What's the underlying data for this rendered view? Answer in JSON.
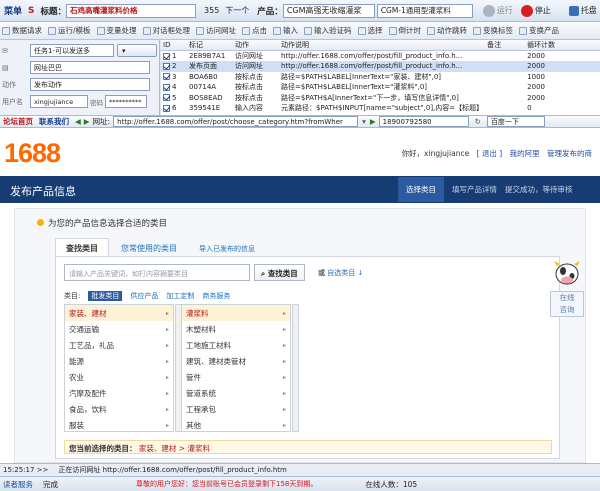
{
  "toolbar": {
    "menu": "菜单",
    "title_label": "标题：",
    "title_value": "石鸡高嘴灌浆料价格",
    "count": "355",
    "next": "下一个",
    "product_label": "产品：",
    "product_value": "CGM高强无收缩灌浆",
    "product_sub": "CGM-1通用型灌浆料",
    "run": "运行",
    "stop": "停止",
    "host": "托盘"
  },
  "actions": [
    "数据请求",
    "运行/模板",
    "变量处理",
    "对话框处理",
    "访问网址",
    "点击",
    "输入",
    "输入验证码",
    "选择",
    "倒计时",
    "动作跳转",
    "变换标签",
    "变换产品"
  ],
  "left_panel": {
    "select1": "任务1-可以发送多",
    "field1": "网址巴巴",
    "action_label": "动作",
    "action_value": "发布动作",
    "user_label": "用户名",
    "user_value": "xingjujiance",
    "pwd_label": "密码",
    "pwd_value": "**********"
  },
  "grid": {
    "headers": [
      "ID",
      "标记",
      "动作",
      "动作说明",
      "备注",
      "循环计数"
    ],
    "rows": [
      {
        "id": "1",
        "mark": "2E89B7A1",
        "action": "访问网址",
        "desc": "http://offer.1688.com/offer/post/fill_product_info.h...",
        "note": "",
        "count": "2000",
        "checked": true,
        "selected": false
      },
      {
        "id": "2",
        "mark": "发布页面",
        "action": "访问网址",
        "desc": "http://offer.1688.com/offer/post/fill_product_info.h...",
        "note": "",
        "count": "2000",
        "checked": true,
        "selected": true
      },
      {
        "id": "3",
        "mark": "BOA6B0",
        "action": "按标点击",
        "desc": "路径=$PATH$LABEL[InnerText=\"家装、建材\",0]",
        "note": "",
        "count": "1000",
        "checked": true,
        "selected": false
      },
      {
        "id": "4",
        "mark": "00714A",
        "action": "按标点击",
        "desc": "路径=$PATH$LABEL[InnerText=\"灌浆料\",0]",
        "note": "",
        "count": "2000",
        "checked": true,
        "selected": false
      },
      {
        "id": "5",
        "mark": "BOS8EAD",
        "action": "按标点击",
        "desc": "路径=$PATH$A[InnerText=\"下一步，填写信息详情\",0]",
        "note": "",
        "count": "2000",
        "checked": true,
        "selected": false
      },
      {
        "id": "6",
        "mark": "359541E",
        "action": "输入内容",
        "desc": "元素路径：$PATH$INPUT[name=\"subject\",0],内容=【标题】",
        "note": "",
        "count": "0",
        "checked": true,
        "selected": false
      },
      {
        "id": "7",
        "mark": "12E7C6",
        "action": "输入内容",
        "desc": "路径=$PATH$INPUT[className=\"sample\",0]",
        "note": "",
        "count": "500",
        "checked": true,
        "selected": false
      }
    ]
  },
  "browser_bar": {
    "link1": "论坛首页",
    "link2": "联系我们",
    "url_label": "网址:",
    "url": "http://offer.1688.com/offer/post/choose_category.htm?fromWher",
    "phone": "18900792580",
    "search": "百度一下"
  },
  "site": {
    "logo": "1688",
    "greeting": "你好，xingjujiance",
    "logout": "[ 退出 ]",
    "my_alibaba": "我的阿里",
    "manage_products": "管理发布的商",
    "header_title": "发布产品信息",
    "steps": [
      "选择类目",
      "填写产品详情",
      "提交成功，等待审核"
    ],
    "question": "为您的产品信息选择合适的类目",
    "tabs": [
      "查找类目",
      "您常使用的类目",
      "导入已发布的信息"
    ],
    "search_placeholder": "请输入产品关键词，如打内容摘要类目",
    "search_button": "查找类目",
    "search_option_prefix": "或",
    "search_option": "自选类目 ↓",
    "category_type_label": "类目:",
    "category_types": [
      "批发类目",
      "供应产品",
      "加工定制",
      "商务服务"
    ],
    "col1": [
      "家装、建材",
      "交通运输",
      "工艺品，礼品",
      "能源",
      "农业",
      "汽摩及配件",
      "食品，饮料",
      "服装"
    ],
    "col2": [
      "灌浆料",
      "木塑材料",
      "工地施工材料",
      "建筑、建材类管材",
      "管件",
      "管道系统",
      "工程承包",
      "其他"
    ],
    "chosen_label": "您当前选择的类目：",
    "chosen_value": "家装、建材 > 灌浆料",
    "online_line1": "在线",
    "online_line2": "咨询"
  },
  "status": {
    "time": "15:25:17 >>",
    "visiting": "正在访问网址 http://offer.1688.com/offer/post/fill_product_info.htm",
    "left_link": "读者服务",
    "done": "完成",
    "notice": "尊敬的用户您好：您当前账号已会员登录剩下158天到期。",
    "online_count": "在线人数：105"
  }
}
